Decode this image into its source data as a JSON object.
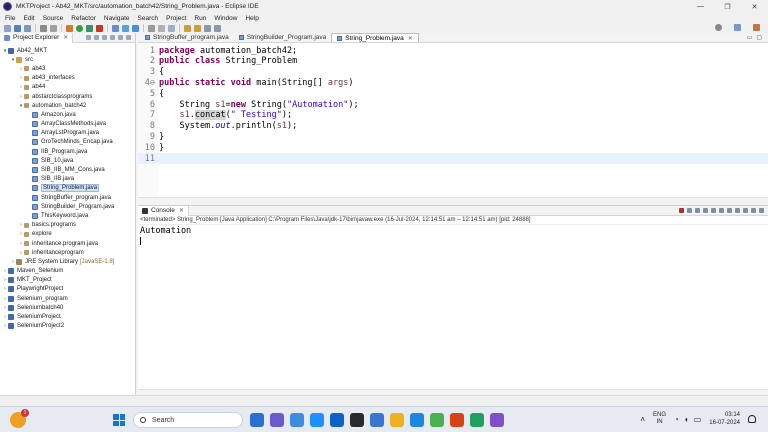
{
  "window": {
    "title": "MKTProject - Ab42_MKT/src/automation_batch42/String_Problem.java - Eclipse IDE",
    "controls": [
      "—",
      "❐",
      "✕"
    ]
  },
  "menu": [
    "File",
    "Edit",
    "Source",
    "Refactor",
    "Navigate",
    "Search",
    "Project",
    "Run",
    "Window",
    "Help"
  ],
  "explorer": {
    "title": "Project Explorer",
    "tree": [
      {
        "label": "Ab42_MKT",
        "level": 0,
        "expanded": true,
        "icon": "project"
      },
      {
        "label": "src",
        "level": 1,
        "expanded": true,
        "icon": "src"
      },
      {
        "label": "ab43",
        "level": 2,
        "expanded": false,
        "icon": "pkg"
      },
      {
        "label": "ab43_interfaces",
        "level": 2,
        "expanded": false,
        "icon": "pkg"
      },
      {
        "label": "ab44",
        "level": 2,
        "expanded": false,
        "icon": "pkg"
      },
      {
        "label": "abstarctclassprograms",
        "level": 2,
        "expanded": false,
        "icon": "pkg"
      },
      {
        "label": "automation_batch42",
        "level": 2,
        "expanded": true,
        "icon": "pkg"
      },
      {
        "label": "Amazon.java",
        "level": 3,
        "expanded": false,
        "icon": "java"
      },
      {
        "label": "ArrayClassMethods.java",
        "level": 3,
        "expanded": false,
        "icon": "java"
      },
      {
        "label": "ArrayLstProgram.java",
        "level": 3,
        "expanded": false,
        "icon": "java"
      },
      {
        "label": "GroTechMinds_Encap.java",
        "level": 3,
        "expanded": false,
        "icon": "java"
      },
      {
        "label": "IIB_Program.java",
        "level": 3,
        "expanded": false,
        "icon": "java"
      },
      {
        "label": "SIB_10.java",
        "level": 3,
        "expanded": false,
        "icon": "java"
      },
      {
        "label": "SIB_IIB_MM_Cons.java",
        "level": 3,
        "expanded": false,
        "icon": "java"
      },
      {
        "label": "SIB_IIB.java",
        "level": 3,
        "expanded": false,
        "icon": "java"
      },
      {
        "label": "String_Problem.java",
        "level": 3,
        "expanded": false,
        "icon": "java",
        "selected": true
      },
      {
        "label": "StringBuffer_program.java",
        "level": 3,
        "expanded": false,
        "icon": "java"
      },
      {
        "label": "StringBuilder_Program.java",
        "level": 3,
        "expanded": false,
        "icon": "java"
      },
      {
        "label": "ThisKeyword.java",
        "level": 3,
        "expanded": false,
        "icon": "java"
      },
      {
        "label": "basics.programs",
        "level": 2,
        "expanded": false,
        "icon": "pkg"
      },
      {
        "label": "explore",
        "level": 2,
        "expanded": false,
        "icon": "pkg"
      },
      {
        "label": "inheritance.program.java",
        "level": 2,
        "expanded": false,
        "icon": "pkg"
      },
      {
        "label": "inheritanceprogram",
        "level": 2,
        "expanded": false,
        "icon": "pkg"
      },
      {
        "label": "JRE System Library",
        "suffix": "[JavaSE-1.8]",
        "level": 1,
        "expanded": false,
        "icon": "lib"
      },
      {
        "label": "Maven_Selenium",
        "level": 0,
        "expanded": false,
        "icon": "project"
      },
      {
        "label": "MKT_Project",
        "level": 0,
        "expanded": false,
        "icon": "project"
      },
      {
        "label": "PlaywrightProject",
        "level": 0,
        "expanded": false,
        "icon": "project"
      },
      {
        "label": "Selenium_program",
        "level": 0,
        "expanded": false,
        "icon": "project"
      },
      {
        "label": "Seleniumbatch40",
        "level": 0,
        "expanded": false,
        "icon": "project"
      },
      {
        "label": "SeleniumProject",
        "level": 0,
        "expanded": false,
        "icon": "project"
      },
      {
        "label": "SeleniumProject2",
        "level": 0,
        "expanded": false,
        "icon": "project"
      }
    ]
  },
  "editor": {
    "tabs": [
      {
        "label": "StringBuffer_program.java",
        "active": false
      },
      {
        "label": "StringBuilder_Program.java",
        "active": false
      },
      {
        "label": "String_Problem.java",
        "active": true
      }
    ],
    "lines": [
      {
        "n": "1",
        "html": "<span class=\"kw\">package</span> automation_batch42;"
      },
      {
        "n": "2",
        "html": "<span class=\"kw\">public class</span> String_Problem"
      },
      {
        "n": "3",
        "html": "{"
      },
      {
        "n": "4⊖",
        "html": "<span class=\"kw\">public static void</span> main(String[] <span class=\"var\">args</span>)"
      },
      {
        "n": "5",
        "html": "{"
      },
      {
        "n": "6",
        "html": "    String <span class=\"var\">s1</span>=<span class=\"kw\">new</span> String(<span class=\"str\">\"Automation\"</span>);"
      },
      {
        "n": "7",
        "html": "    <span class=\"var\">s1</span>.<span class=\"hl\">concat</span>(<span class=\"str\">\" Testing\"</span>);"
      },
      {
        "n": "8",
        "html": "    System.<span class=\"field\">out</span>.println(<span class=\"var\">s1</span>);"
      },
      {
        "n": "9",
        "html": "}"
      },
      {
        "n": "10",
        "html": "}"
      },
      {
        "n": "11",
        "html": "",
        "current": true
      }
    ]
  },
  "console": {
    "title": "Console",
    "terminated": "<terminated> String_Problem [Java Application] C:\\Program Files\\Java\\jdk-17\\bin\\javaw.exe  (16-Jul-2024, 12:14:51 am – 12:14:51 am) [pid: 24888]",
    "output": "Automation"
  },
  "taskbar": {
    "search_placeholder": "Search",
    "weather_badge": "1",
    "lang_top": "ENG",
    "lang_bottom": "IN",
    "time": "03:14",
    "date": "16-07-2024",
    "apps": [
      "#2d6fd0",
      "#6a5acd",
      "#3c8dde",
      "#1e90ff",
      "#0b63c5",
      "#2a2a2a",
      "#3a76d0",
      "#f0b020",
      "#1a88e0",
      "#4caf50",
      "#d84315",
      "#20a060",
      "#8050c8"
    ]
  }
}
